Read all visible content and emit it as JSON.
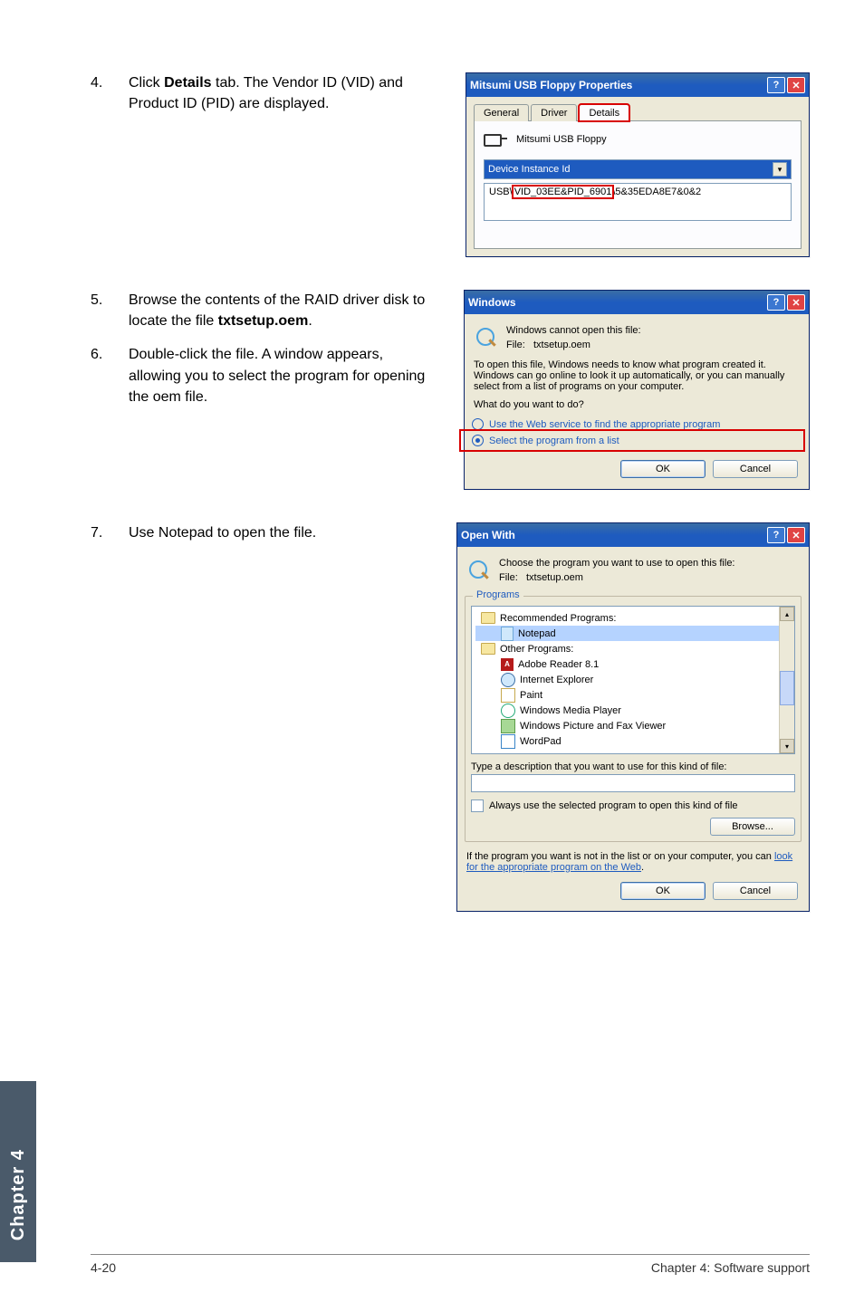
{
  "steps": {
    "s4_num": "4.",
    "s4_a": "Click ",
    "s4_b": "Details",
    "s4_c": " tab. The Vendor ID (VID) and Product ID (PID) are displayed.",
    "s5_num": "5.",
    "s5_a": "Browse the contents of the RAID driver disk to locate the file ",
    "s5_b": "txtsetup.oem",
    "s5_c": ".",
    "s6_num": "6.",
    "s6": "Double-click the file. A window appears, allowing you to select the program for opening the oem file.",
    "s7_num": "7.",
    "s7": "Use Notepad to open the file."
  },
  "d1": {
    "title": "Mitsumi USB Floppy Properties",
    "tab_general": "General",
    "tab_driver": "Driver",
    "tab_details": "Details",
    "device_name": "Mitsumi USB Floppy",
    "dropdown": "Device Instance Id",
    "val_prefix": "USB\\",
    "val_boxed": "VID_03EE&PID_6901",
    "val_suffix": "\\5&35EDA8E7&0&2"
  },
  "d2": {
    "title": "Windows",
    "line1": "Windows cannot open this file:",
    "file_label": "File:",
    "file_name": "txtsetup.oem",
    "para": "To open this file, Windows needs to know what program created it.  Windows can go online to look it up automatically, or you can manually select from a list of programs on your computer.",
    "q": "What do you want to do?",
    "opt1": "Use the Web service to find the appropriate program",
    "opt2": "Select the program from a list",
    "ok": "OK",
    "cancel": "Cancel"
  },
  "d3": {
    "title": "Open With",
    "line1": "Choose the program you want to use to open this file:",
    "file_label": "File:",
    "file_name": "txtsetup.oem",
    "group": "Programs",
    "rec": "Recommended Programs:",
    "notepad": "Notepad",
    "other": "Other Programs:",
    "p_adobe": "Adobe Reader 8.1",
    "p_ie": "Internet Explorer",
    "p_paint": "Paint",
    "p_wmp": "Windows Media Player",
    "p_pfax": "Windows Picture and Fax Viewer",
    "p_wp": "WordPad",
    "type_desc": "Type a description that you want to use for this kind of file:",
    "always": "Always use the selected program to open this kind of file",
    "browse": "Browse...",
    "help_a": "If the program you want is not in the list or on your computer, you can ",
    "help_link": "look for the appropriate program on the Web",
    "help_b": ".",
    "ok": "OK",
    "cancel": "Cancel"
  },
  "titlebar": {
    "help": "?",
    "close": "✕"
  },
  "sidetab": "Chapter 4",
  "footer": {
    "page": "4-20",
    "chapter": "Chapter 4: Software support"
  },
  "glyph": {
    "down": "▾",
    "up": "▴"
  }
}
